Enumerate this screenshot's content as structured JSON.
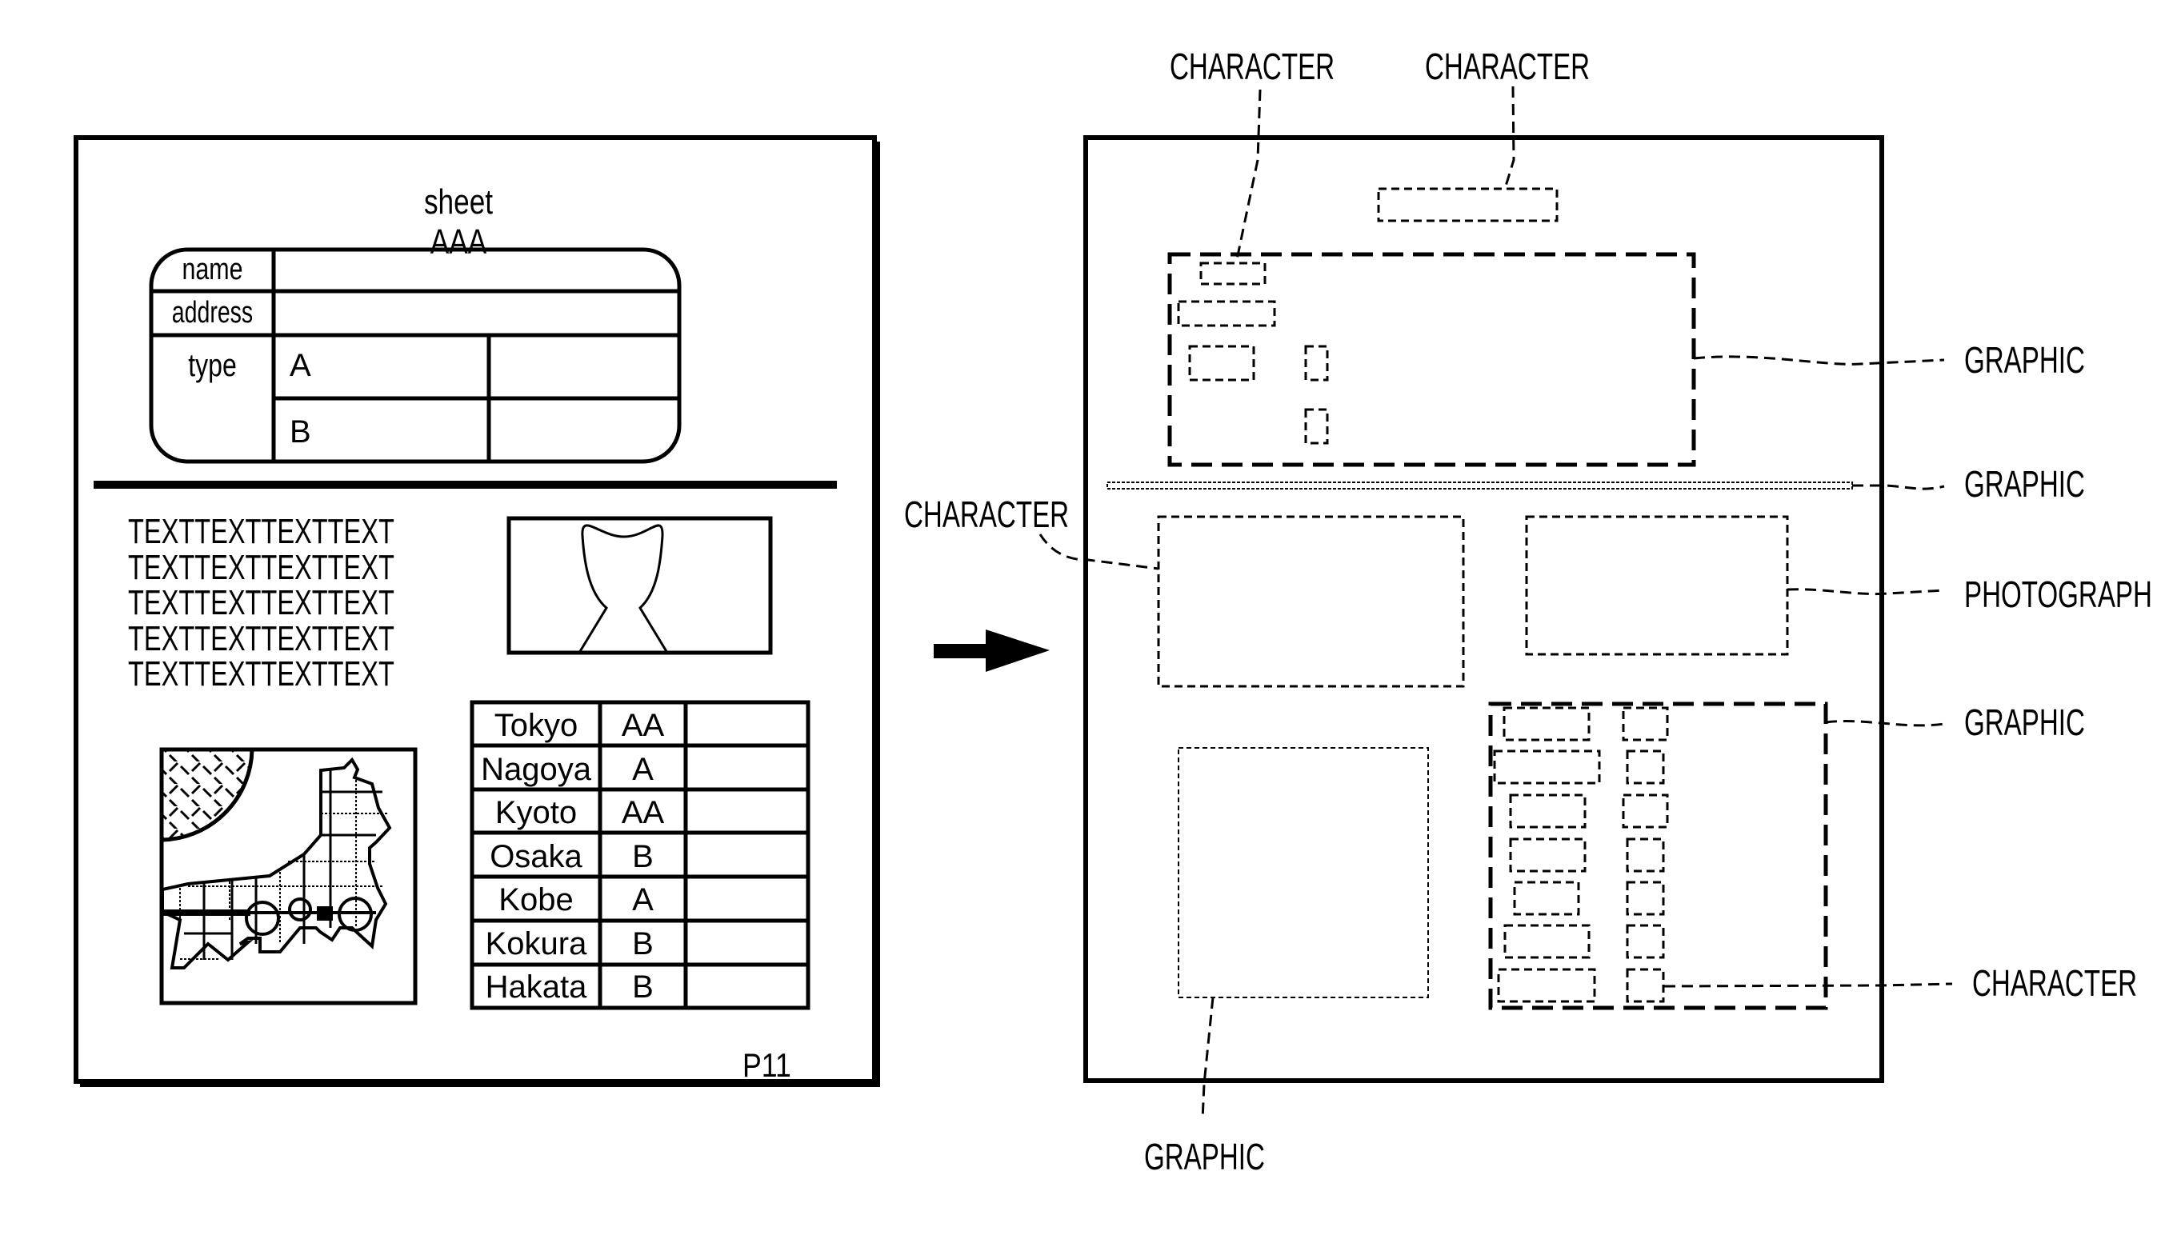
{
  "figure": {
    "arrow": "right-arrow"
  },
  "source_document": {
    "title": "sheet AAA",
    "form": {
      "rows": [
        {
          "label": "name"
        },
        {
          "label": "address"
        },
        {
          "label": "type",
          "options": [
            "A",
            "B"
          ]
        }
      ]
    },
    "text_lines": [
      "TEXTTEXTTEXTTEXT",
      "TEXTTEXTTEXTTEXT",
      "TEXTTEXTTEXTTEXT",
      "TEXTTEXTTEXTTEXT",
      "TEXTTEXTTEXTTEXT"
    ],
    "photo": "person-silhouette",
    "map": "map-illustration",
    "city_table": [
      {
        "city": "Tokyo",
        "grade": "AA",
        "extra": ""
      },
      {
        "city": "Nagoya",
        "grade": "A",
        "extra": ""
      },
      {
        "city": "Kyoto",
        "grade": "AA",
        "extra": ""
      },
      {
        "city": "Osaka",
        "grade": "B",
        "extra": ""
      },
      {
        "city": "Kobe",
        "grade": "A",
        "extra": ""
      },
      {
        "city": "Kokura",
        "grade": "B",
        "extra": ""
      },
      {
        "city": "Hakata",
        "grade": "B",
        "extra": ""
      }
    ],
    "page_label": "P11"
  },
  "analysis": {
    "labels": {
      "character_top_left": "CHARACTER",
      "character_top_right": "CHARACTER",
      "graphic_form": "GRAPHIC",
      "graphic_divider": "GRAPHIC",
      "character_text": "CHARACTER",
      "photograph": "PHOTOGRAPH",
      "graphic_table": "GRAPHIC",
      "character_table_cell": "CHARACTER",
      "graphic_map": "GRAPHIC"
    }
  }
}
